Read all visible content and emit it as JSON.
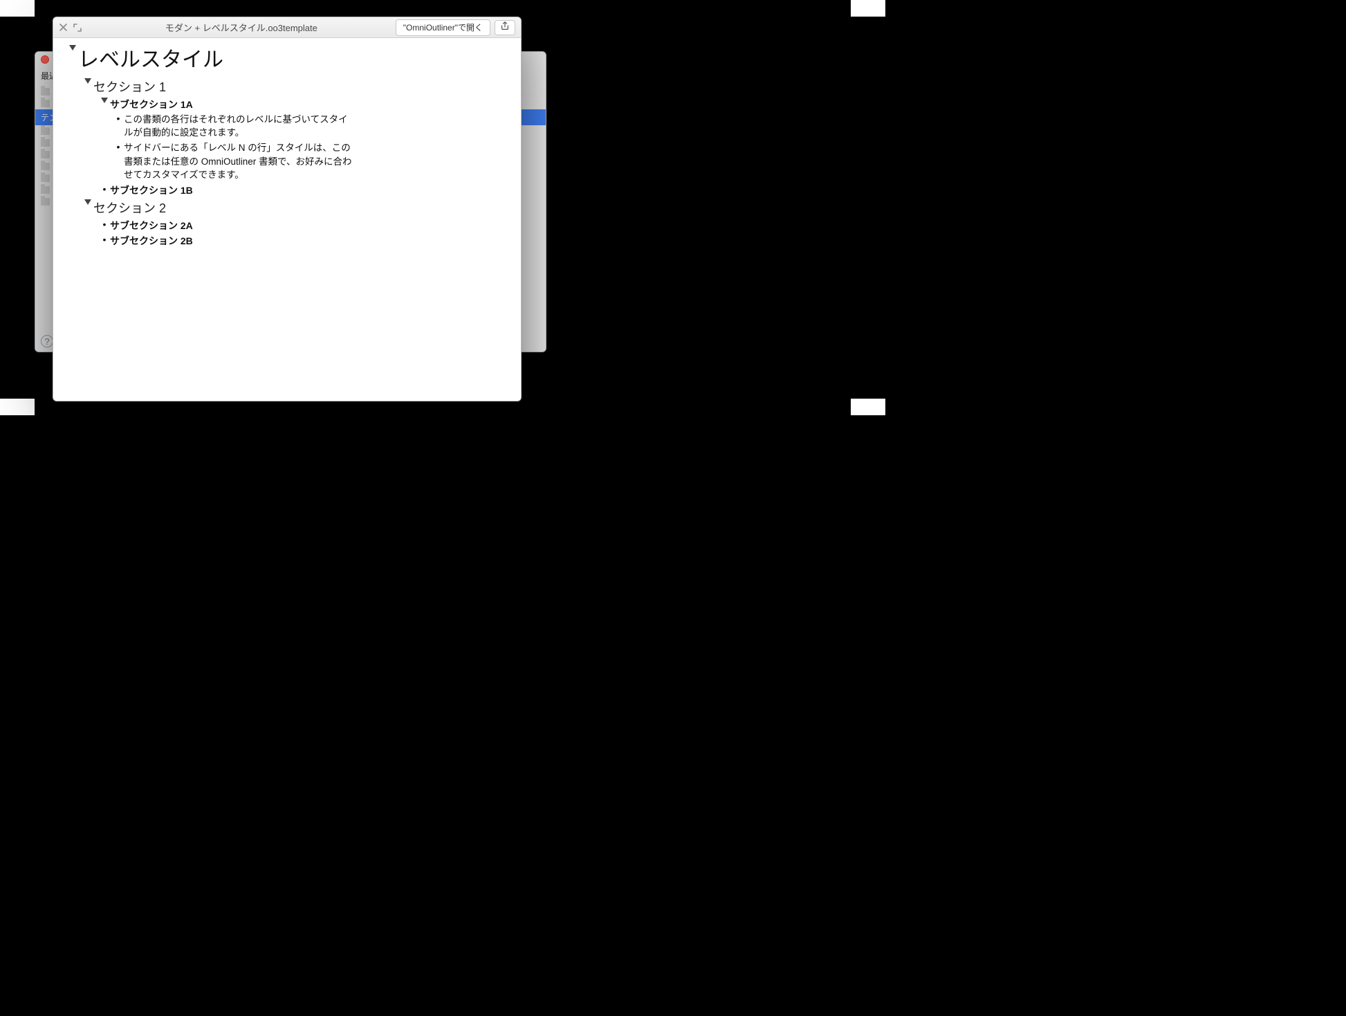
{
  "bg": {
    "sidebar_section_1": "最近",
    "sidebar_selected_label": "テン"
  },
  "titlebar": {
    "title": "モダン + レベルスタイル.oo3template",
    "open_button": "\"OmniOutliner\"で開く"
  },
  "outline": {
    "title": "レベルスタイル",
    "section1": {
      "label": "セクション 1",
      "sub1a": "サブセクション 1A",
      "bullet1": "この書類の各行はそれぞれのレベルに基づいてスタイルが自動的に設定されます。",
      "bullet2": "サイドバーにある「レベル N の行」スタイルは、この書類または任意の OmniOutliner 書類で、お好みに合わせてカスタマイズできます。",
      "sub1b": "サブセクション 1B"
    },
    "section2": {
      "label": "セクション 2",
      "sub2a": "サブセクション 2A",
      "sub2b": "サブセクション 2B"
    }
  }
}
